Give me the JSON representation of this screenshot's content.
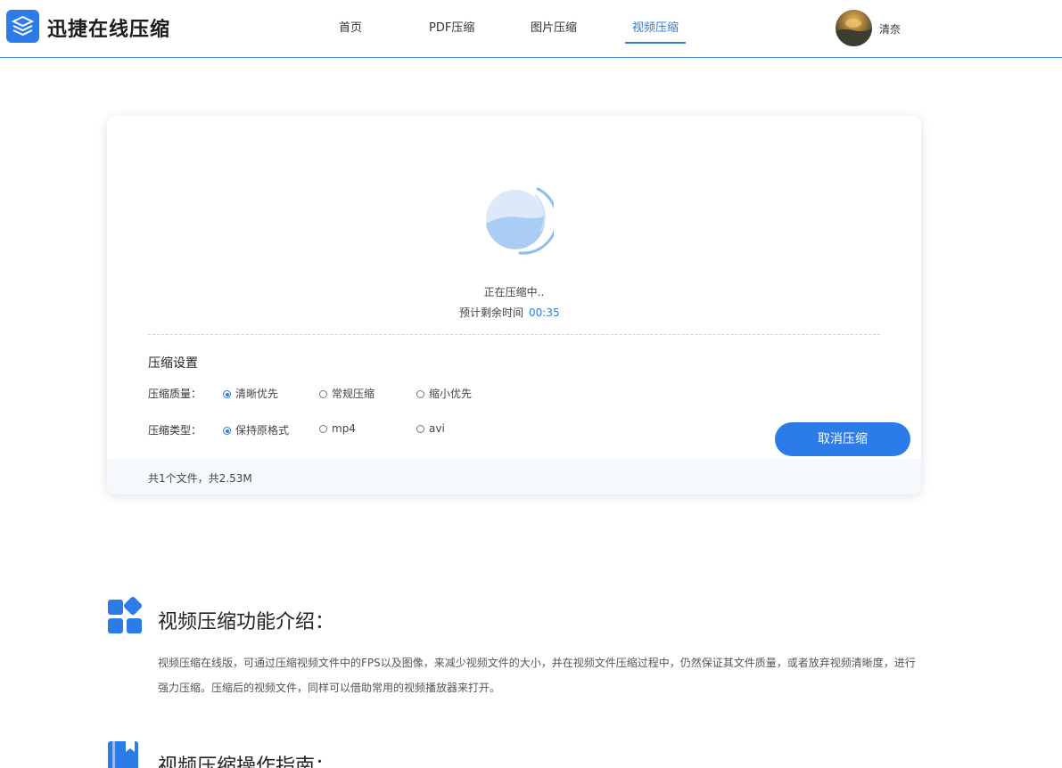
{
  "header": {
    "brand": "迅捷在线压缩",
    "nav": [
      "首页",
      "PDF压缩",
      "图片压缩",
      "视频压缩"
    ],
    "active_nav_index": 3,
    "username": "清奈"
  },
  "progress": {
    "status": "正在压缩中..",
    "eta_label": "预计剩余时间",
    "eta_value": "00:35"
  },
  "settings": {
    "title": "压缩设置",
    "quality": {
      "label": "压缩质量：",
      "options": [
        "清晰优先",
        "常规压缩",
        "缩小优先"
      ],
      "selected_index": 0
    },
    "type": {
      "label": "压缩类型：",
      "options": [
        "保持原格式",
        "mp4",
        "avi"
      ],
      "selected_index": 0
    },
    "cancel_label": "取消压缩",
    "file_summary": "共1个文件，共2.53M"
  },
  "intro": {
    "title": "视频压缩功能介绍：",
    "text": "视频压缩在线版，可通过压缩视频文件中的FPS以及图像，来减少视频文件的大小，并在视频文件压缩过程中，仍然保证其文件质量，或者放弃视频清晰度，进行强力压缩。压缩后的视频文件，同样可以借助常用的视频播放器来打开。"
  },
  "guide": {
    "title": "视频压缩操作指南："
  },
  "colors": {
    "accent": "#2b7ce8",
    "card_footer_bg": "#f5f8fc"
  }
}
